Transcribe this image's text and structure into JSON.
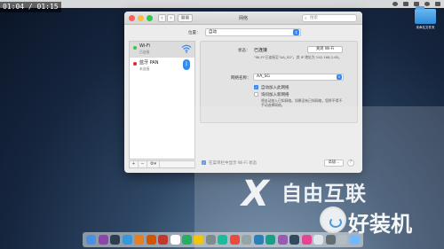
{
  "timer": "01:04 / 01:15",
  "desktop": {
    "folder_label": "未命名文件夹"
  },
  "window": {
    "title": "网络",
    "search_placeholder": "搜索",
    "location_label": "位置：",
    "location_value": "自动"
  },
  "services": [
    {
      "name": "Wi-Fi",
      "status": "已连接",
      "status_color": "#2ecc40"
    },
    {
      "name": "蓝牙 PAN",
      "status": "未连接",
      "status_color": "#e0262b"
    }
  ],
  "sidebar_controls": [
    "+",
    "−",
    "⚙▾"
  ],
  "pane": {
    "status_label": "状态：",
    "status_value": "已连接",
    "turn_off_button": "关闭 Wi-Fi",
    "status_desc": "\"Wi-Fi\"已连接至\"AA_SG\"，其 IP 地址为 192.168.2.65。",
    "network_label": "网络名称：",
    "network_value": "AA_SG",
    "auto_join_label": "自动加入此网络",
    "ask_join_label": "询问加入新网络",
    "ask_join_desc": "将自动加入已知网络。如果没有已知网络，您将不得不手动选择网络。",
    "auto_join_checked": true,
    "ask_join_checked": false
  },
  "bottom": {
    "show_status_label": "在菜单栏中显示 Wi-Fi 状态",
    "show_status_checked": true,
    "advanced_button": "高级...",
    "help_button": "?"
  },
  "watermark": {
    "brand_x": "X",
    "brand_text": "自由互联",
    "brand2_text": "好装机"
  },
  "dock_colors": [
    "#4a90e2",
    "#8e44ad",
    "#2c3e50",
    "#3498db",
    "#e67e22",
    "#d35400",
    "#c0392b",
    "#ffffff",
    "#27ae60",
    "#f1c40f",
    "#7f8c8d",
    "#1abc9c",
    "#e74c3c",
    "#95a5a6",
    "#2980b9",
    "#16a085",
    "#9b59b6",
    "#34495e",
    "#e84393",
    "#dfe6e9",
    "#636e72",
    "#b2bec3",
    "#74b9ff"
  ]
}
